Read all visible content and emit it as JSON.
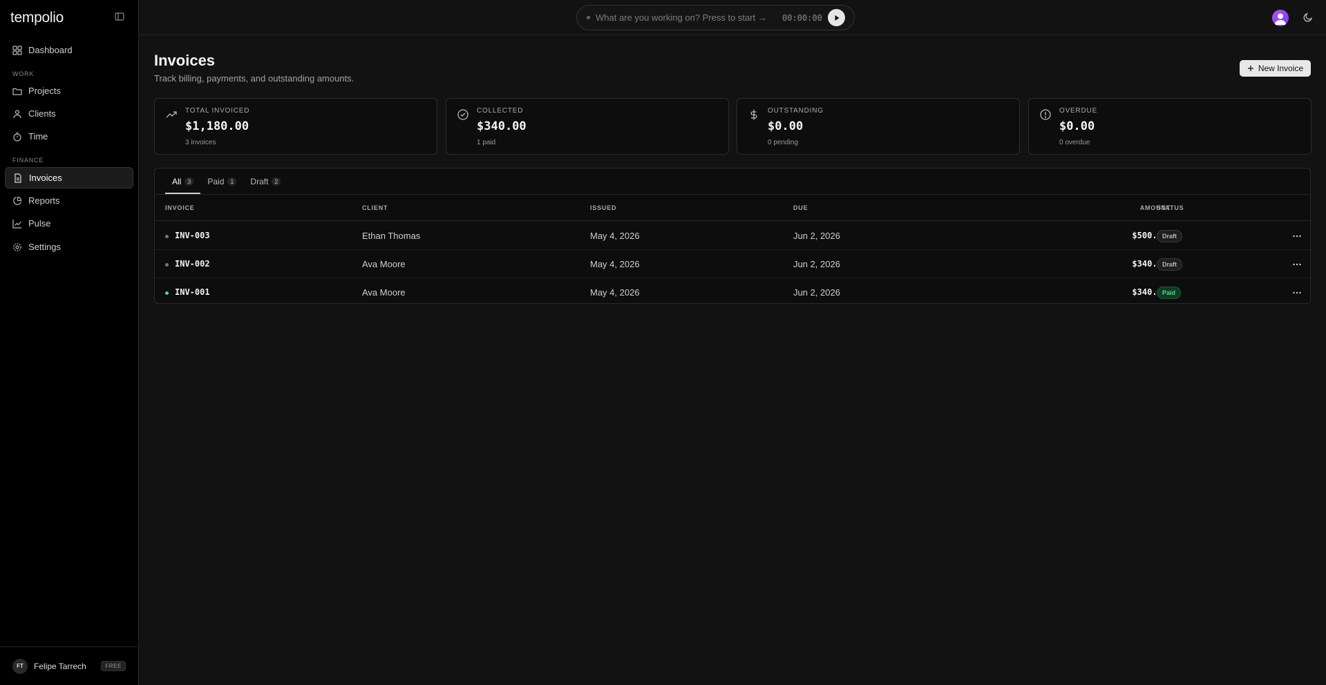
{
  "app": {
    "logo": "tempolio"
  },
  "sidebar": {
    "items": [
      {
        "label": "Dashboard"
      },
      {
        "label": "Projects"
      },
      {
        "label": "Clients"
      },
      {
        "label": "Time"
      },
      {
        "label": "Invoices"
      },
      {
        "label": "Reports"
      },
      {
        "label": "Pulse"
      },
      {
        "label": "Settings"
      }
    ],
    "sections": {
      "work": "WORK",
      "finance": "FINANCE"
    },
    "active": "Invoices"
  },
  "user": {
    "initials": "FT",
    "name": "Felipe Tarrech",
    "plan": "FREE"
  },
  "timer": {
    "placeholder": "What are you working on? Press to start →",
    "clock": "00:00:00"
  },
  "page": {
    "title": "Invoices",
    "subtitle": "Track billing, payments, and outstanding amounts.",
    "new_button": "New Invoice"
  },
  "stats": [
    {
      "label": "TOTAL INVOICED",
      "value": "$1,180.00",
      "sub": "3 invoices",
      "icon": "trending-up-icon"
    },
    {
      "label": "COLLECTED",
      "value": "$340.00",
      "sub": "1 paid",
      "icon": "check-circle-icon"
    },
    {
      "label": "OUTSTANDING",
      "value": "$0.00",
      "sub": "0 pending",
      "icon": "dollar-icon"
    },
    {
      "label": "OVERDUE",
      "value": "$0.00",
      "sub": "0 overdue",
      "icon": "alert-circle-icon"
    }
  ],
  "tabs": [
    {
      "label": "All",
      "count": "3"
    },
    {
      "label": "Paid",
      "count": "1"
    },
    {
      "label": "Draft",
      "count": "2"
    }
  ],
  "table": {
    "headers": {
      "invoice": "INVOICE",
      "client": "CLIENT",
      "issued": "ISSUED",
      "due": "DUE",
      "amount": "AMOUNT",
      "status": "STATUS"
    },
    "rows": [
      {
        "id": "INV-003",
        "client": "Ethan Thomas",
        "issued": "May 4, 2026",
        "due": "Jun 2, 2026",
        "amount": "$500.00",
        "status": "Draft"
      },
      {
        "id": "INV-002",
        "client": "Ava Moore",
        "issued": "May 4, 2026",
        "due": "Jun 2, 2026",
        "amount": "$340.00",
        "status": "Draft"
      },
      {
        "id": "INV-001",
        "client": "Ava Moore",
        "issued": "May 4, 2026",
        "due": "Jun 2, 2026",
        "amount": "$340.00",
        "status": "Paid"
      }
    ]
  },
  "colors": {
    "paid": "#4ade80",
    "draft": "#777777",
    "accent": "#a855f7"
  }
}
